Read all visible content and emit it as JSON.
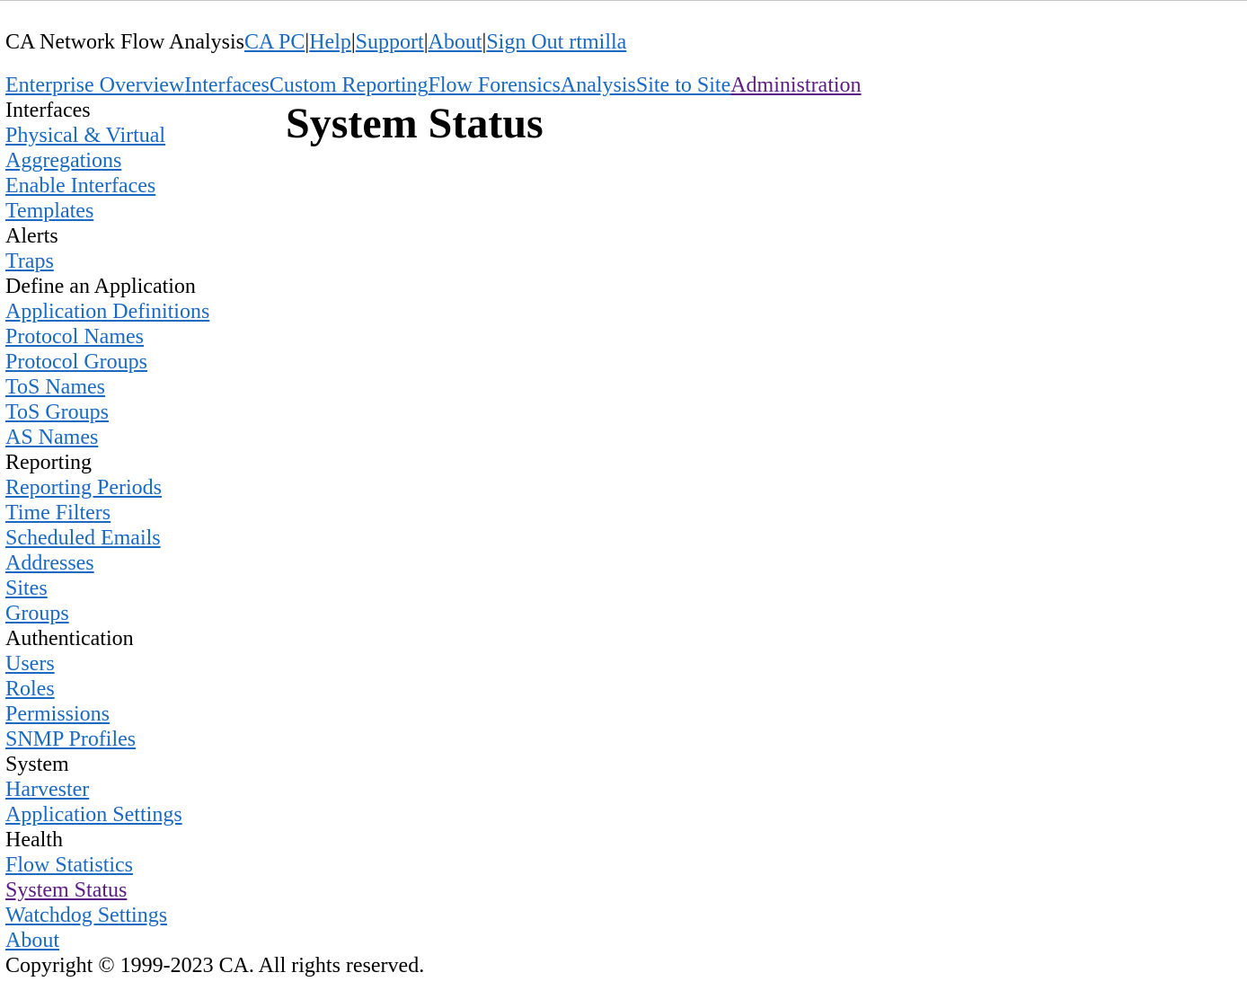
{
  "header": {
    "app_name": "CA Network Flow Analysis",
    "links": [
      {
        "label": "CA PC"
      },
      {
        "label": "Help"
      },
      {
        "label": "Support"
      },
      {
        "label": "About"
      },
      {
        "label": "Sign Out rtmilla"
      }
    ],
    "separator": "|"
  },
  "nav": {
    "tabs": [
      {
        "label": "Enterprise Overview"
      },
      {
        "label": "Interfaces"
      },
      {
        "label": "Custom Reporting"
      },
      {
        "label": "Flow Forensics"
      },
      {
        "label": "Analysis"
      },
      {
        "label": "Site to Site"
      },
      {
        "label": "Administration",
        "active": true
      }
    ]
  },
  "sidebar": {
    "sections": [
      {
        "heading": "Interfaces",
        "items": [
          "Physical & Virtual",
          "Aggregations",
          "Enable Interfaces",
          "Templates"
        ]
      },
      {
        "heading": "Alerts",
        "items": [
          "Traps"
        ]
      },
      {
        "heading": "Define an Application",
        "items": [
          "Application Definitions",
          "Protocol Names",
          "Protocol Groups",
          "ToS Names",
          "ToS Groups",
          "AS Names"
        ]
      },
      {
        "heading": "Reporting",
        "items": [
          "Reporting Periods",
          "Time Filters",
          "Scheduled Emails",
          "Addresses",
          "Sites",
          "Groups"
        ]
      },
      {
        "heading": "Authentication",
        "items": [
          "Users",
          "Roles",
          "Permissions",
          "SNMP Profiles"
        ]
      },
      {
        "heading": "System",
        "items": [
          "Harvester",
          "Application Settings"
        ]
      },
      {
        "heading": "Health",
        "items": [
          "Flow Statistics",
          "System Status",
          "Watchdog Settings",
          "About"
        ]
      }
    ],
    "current_item": "System Status"
  },
  "main": {
    "title": "System Status"
  },
  "footer": {
    "copyright": "Copyright © 1999-2023 CA. All rights reserved."
  },
  "colors": {
    "link": "#1a6ac4",
    "visited_link": "#5b1d82",
    "text": "#000000",
    "background": "#ffffff"
  }
}
